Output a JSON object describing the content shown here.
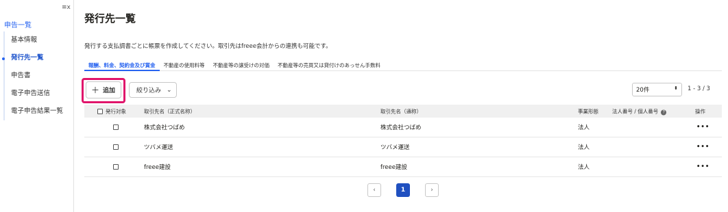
{
  "sidebar": {
    "collapse_icon": "≡x",
    "top_label": "申告一覧",
    "items": [
      {
        "label": "基本情報",
        "active": false
      },
      {
        "label": "発行先一覧",
        "active": true
      },
      {
        "label": "申告書",
        "active": false
      },
      {
        "label": "電子申告送信",
        "active": false
      },
      {
        "label": "電子申告結果一覧",
        "active": false
      }
    ]
  },
  "main": {
    "title": "発行先一覧",
    "description": "発行する支払調書ごとに帳票を作成してください。取引先はfreee会計からの連携も可能です。",
    "tabs": [
      {
        "label": "報酬、料金、契約金及び賞金",
        "active": true
      },
      {
        "label": "不動産の使用料等",
        "active": false
      },
      {
        "label": "不動産等の譲受けの対価",
        "active": false
      },
      {
        "label": "不動産等の売買又は貸付けのあっせん手数料",
        "active": false
      }
    ],
    "toolbar": {
      "add_icon": "＋",
      "add_label": "追加",
      "filter_label": "絞り込み",
      "filter_icon": "⌄",
      "per_page_value": "20件",
      "per_page_icon": "⬍",
      "count_text": "1 - 3 / 3"
    },
    "table": {
      "headers": {
        "target": "発行対象",
        "formal_name": "取引先名（正式名称）",
        "common_name": "取引先名（通称）",
        "entity_type": "事業形態",
        "corp_number": "法人番号 / 個人番号",
        "help_icon": "?",
        "actions": "操作"
      },
      "rows": [
        {
          "formal_name": "株式会社つばめ",
          "common_name": "株式会社つばめ",
          "entity_type": "法人",
          "menu": "•••"
        },
        {
          "formal_name": "ツバメ運送",
          "common_name": "ツバメ運送",
          "entity_type": "法人",
          "menu": "•••"
        },
        {
          "formal_name": "freee建設",
          "common_name": "freee建設",
          "entity_type": "法人",
          "menu": "•••"
        }
      ]
    },
    "pagination": {
      "prev_icon": "‹",
      "current_page": "1",
      "next_icon": "›"
    }
  },
  "colors": {
    "accent": "#2864f0",
    "highlight": "#e0156b",
    "page_button": "#2050c0"
  }
}
